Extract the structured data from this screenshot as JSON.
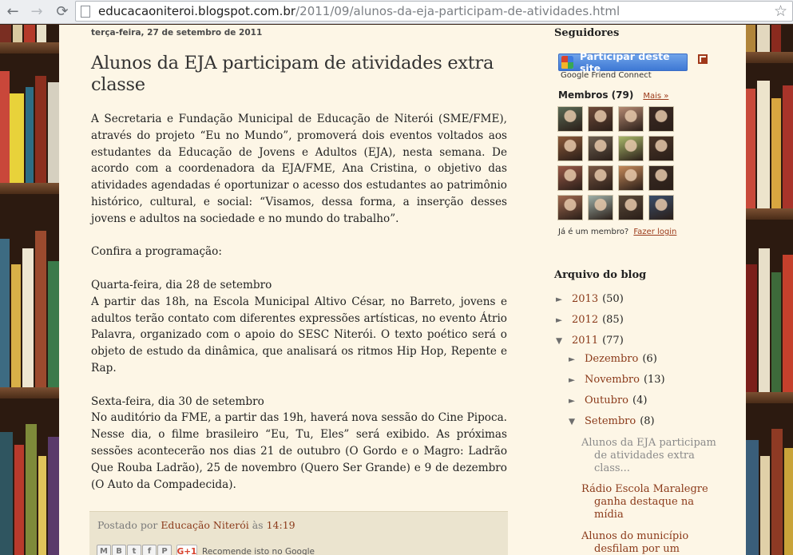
{
  "browser": {
    "url_host": "educacaoniteroi.blogspot.com.br",
    "url_path": "/2011/09/alunos-da-eja-participam-de-atividades.html"
  },
  "post": {
    "date": "terça-feira, 27 de setembro de 2011",
    "title": "Alunos da EJA participam de atividades extra classe",
    "paragraphs": [
      "A Secretaria e Fundação Municipal de Educação de Niterói (SME/FME), através do projeto “Eu no Mundo”, promoverá dois eventos voltados aos estudantes da Educação de Jovens e Adultos (EJA), nesta semana. De acordo com a coordenadora da EJA/FME, Ana Cristina, o objetivo das atividades agendadas é oportunizar o acesso dos estudantes ao patrimônio histórico, cultural, e social: “Visamos, dessa forma, a inserção desses jovens e adultos na sociedade e no mundo do trabalho”.",
      "Confira a programação:",
      "Quarta-feira, dia 28 de setembro",
      "A partir das 18h, na Escola Municipal Altivo César, no Barreto, jovens e adultos terão contato com diferentes expressões artísticas, no evento Átrio Palavra, organizado com o apoio do SESC Niterói. O texto poético será o objeto de estudo da dinâmica, que analisará os ritmos Hip Hop, Repente e Rap.",
      "Sexta-feira, dia 30 de setembro",
      "No auditório da FME, a partir das 19h, haverá nova sessão do Cine Pipoca. Nesse dia, o filme brasileiro “Eu, Tu, Eles” será exibido. As próximas sessões acontecerão nos dias 21 de outubro (O Gordo e o Magro: Ladrão Que Rouba Ladrão), 25 de novembro (Quero Ser Grande) e 9 de dezembro (O Auto da Compadecida)."
    ],
    "footer": {
      "posted_by": "Postado por",
      "author": "Educação Niterói",
      "at": "às",
      "time": "14:19",
      "share_icons": [
        "email-icon",
        "blog-this-icon",
        "twitter-icon",
        "facebook-icon",
        "pinterest-icon"
      ],
      "gplus_label": "G+1",
      "recommend": "Recomende isto no Google"
    }
  },
  "sidebar": {
    "followers": {
      "title": "Seguidores",
      "join_button": "Participar deste site",
      "gfc": "Google Friend Connect",
      "members_title": "Membros (79)",
      "more": "Mais »",
      "avatar_colors": [
        "#5b6a55",
        "#6f4b3a",
        "#b58a72",
        "#3c2a24",
        "#8c5a3a",
        "#6e6152",
        "#a9b86a",
        "#4a3528",
        "#9a5a48",
        "#7a5844",
        "#c58a5a",
        "#3a2c24",
        "#a06a50",
        "#9fb0a8",
        "#5a4a3a",
        "#3a4e6a"
      ],
      "member_question": "Já é um membro?",
      "login": "Fazer login"
    },
    "archive": {
      "title": "Arquivo do blog",
      "years": [
        {
          "label": "2013",
          "count": "(50)",
          "arrow": "►"
        },
        {
          "label": "2012",
          "count": "(85)",
          "arrow": "►"
        },
        {
          "label": "2011",
          "count": "(77)",
          "arrow": "▼"
        }
      ],
      "months": [
        {
          "label": "Dezembro",
          "count": "(6)",
          "arrow": "►"
        },
        {
          "label": "Novembro",
          "count": "(13)",
          "arrow": "►"
        },
        {
          "label": "Outubro",
          "count": "(4)",
          "arrow": "►"
        },
        {
          "label": "Setembro",
          "count": "(8)",
          "arrow": "▼"
        }
      ],
      "posts": [
        "Alunos da EJA participam de atividades extra class...",
        "Rádio Escola Maralegre ganha destaque na mídia",
        "Alunos do município desfilam por um"
      ]
    }
  }
}
